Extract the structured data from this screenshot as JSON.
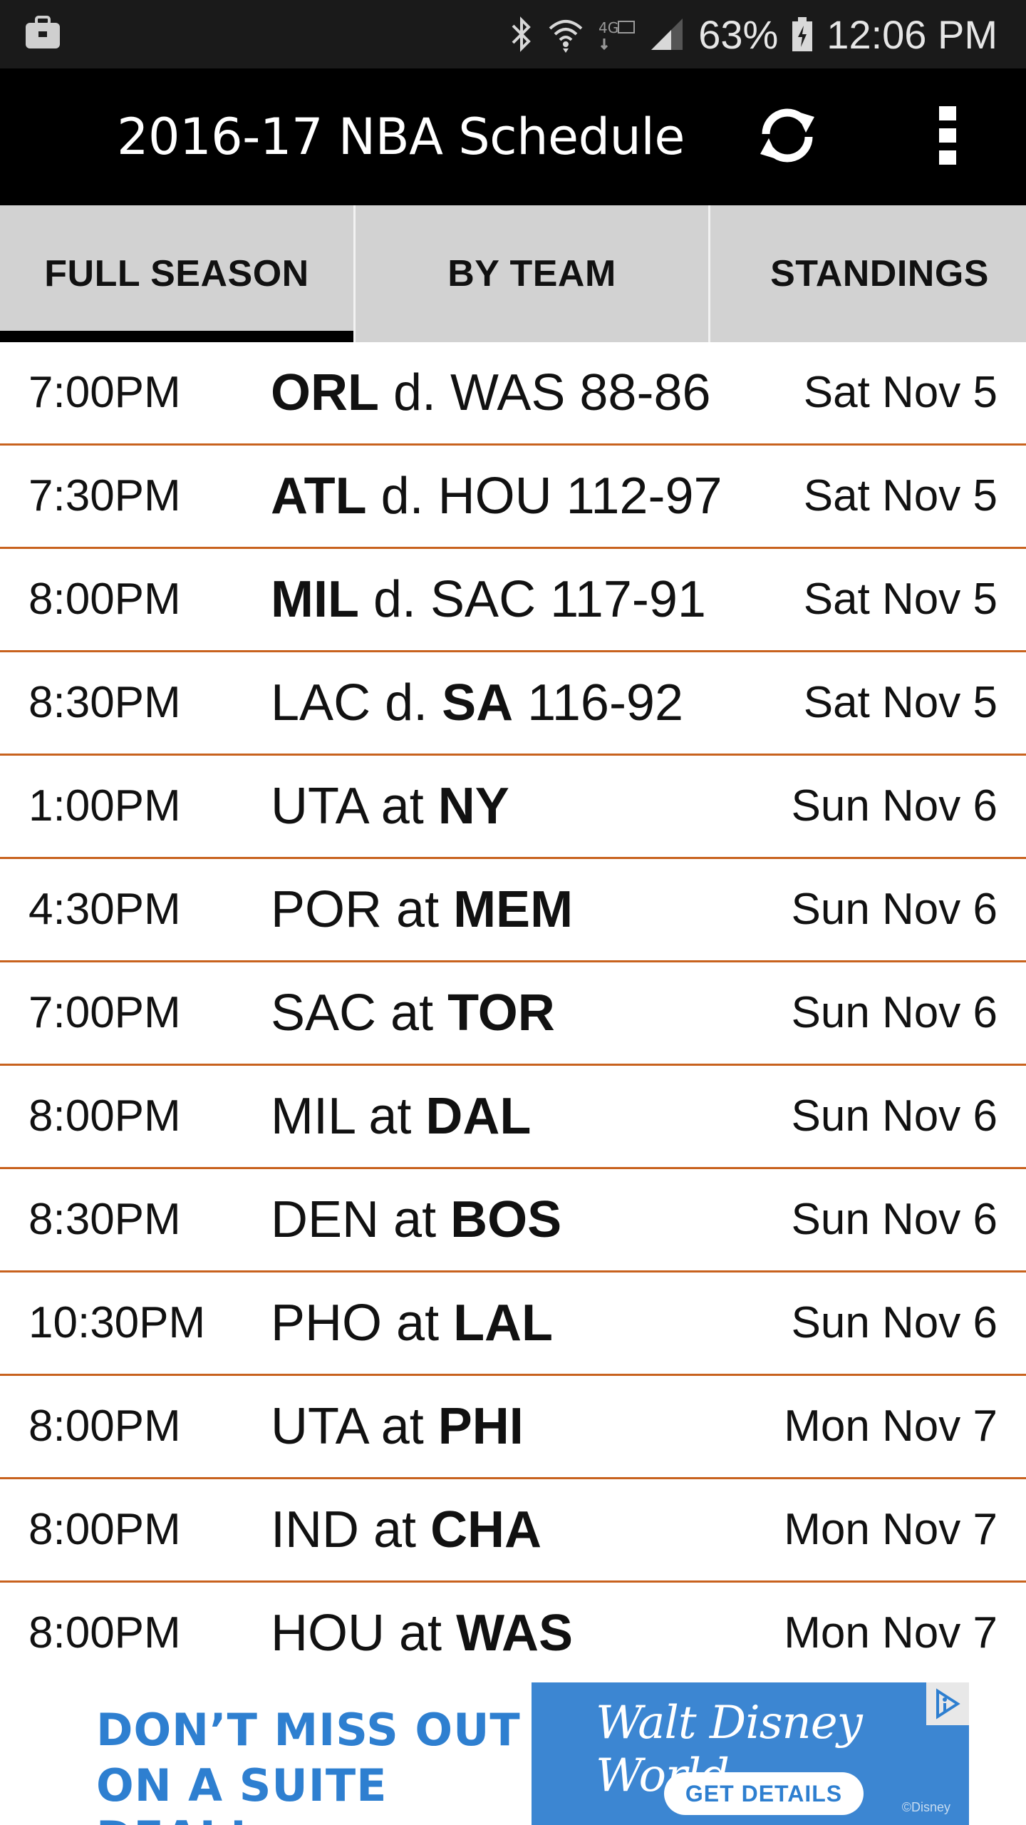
{
  "status_bar": {
    "left_icon": "briefcase-icon",
    "battery": "63%",
    "time": "12:06 PM",
    "icons": [
      "bluetooth-icon",
      "wifi-icon",
      "lte-icon",
      "signal-icon",
      "battery-charging-icon"
    ]
  },
  "app_bar": {
    "title": "2016-17 NBA Schedule",
    "refresh_icon": "refresh-icon",
    "menu_icon": "overflow-menu-icon"
  },
  "tabs": [
    {
      "label": "FULL SEASON",
      "active": true
    },
    {
      "label": "BY TEAM",
      "active": false
    },
    {
      "label": "STANDINGS",
      "active": false
    }
  ],
  "games": [
    {
      "time": "7:00PM",
      "pre": "",
      "b1": "ORL",
      "mid": " d. WAS 88-86",
      "b2": "",
      "post": "",
      "date": "Sat Nov 5"
    },
    {
      "time": "7:30PM",
      "pre": "",
      "b1": "ATL",
      "mid": " d. HOU 112-97",
      "b2": "",
      "post": "",
      "date": "Sat Nov 5"
    },
    {
      "time": "8:00PM",
      "pre": "",
      "b1": "MIL",
      "mid": " d. SAC 117-91",
      "b2": "",
      "post": "",
      "date": "Sat Nov 5"
    },
    {
      "time": "8:30PM",
      "pre": "LAC d. ",
      "b1": "SA",
      "mid": " 116-92",
      "b2": "",
      "post": "",
      "date": "Sat Nov 5"
    },
    {
      "time": "1:00PM",
      "pre": "UTA at ",
      "b1": "NY",
      "mid": "",
      "b2": "",
      "post": "",
      "date": "Sun Nov 6"
    },
    {
      "time": "4:30PM",
      "pre": "POR at ",
      "b1": "MEM",
      "mid": "",
      "b2": "",
      "post": "",
      "date": "Sun Nov 6"
    },
    {
      "time": "7:00PM",
      "pre": "SAC at ",
      "b1": "TOR",
      "mid": "",
      "b2": "",
      "post": "",
      "date": "Sun Nov 6"
    },
    {
      "time": "8:00PM",
      "pre": "MIL at ",
      "b1": "DAL",
      "mid": "",
      "b2": "",
      "post": "",
      "date": "Sun Nov 6"
    },
    {
      "time": "8:30PM",
      "pre": "DEN at ",
      "b1": "BOS",
      "mid": "",
      "b2": "",
      "post": "",
      "date": "Sun Nov 6"
    },
    {
      "time": "10:30PM",
      "pre": "PHO at ",
      "b1": "LAL",
      "mid": "",
      "b2": "",
      "post": "",
      "date": "Sun Nov 6"
    },
    {
      "time": "8:00PM",
      "pre": "UTA at ",
      "b1": "PHI",
      "mid": "",
      "b2": "",
      "post": "",
      "date": "Mon Nov 7"
    },
    {
      "time": "8:00PM",
      "pre": "IND at ",
      "b1": "CHA",
      "mid": "",
      "b2": "",
      "post": "",
      "date": "Mon Nov 7"
    },
    {
      "time": "8:00PM",
      "pre": "HOU at ",
      "b1": "WAS",
      "mid": "",
      "b2": "",
      "post": "",
      "date": "Mon Nov 7"
    }
  ],
  "ad": {
    "headline_1": "DON’T MISS OUT",
    "headline_2": "ON A SUITE DEAL!",
    "brand": "Walt Disney World.",
    "cta": "GET DETAILS",
    "copyright": "©Disney",
    "adchoices_icon": "adchoices-icon"
  },
  "colors": {
    "app_bar": "#000000",
    "status_bar": "#1a1a1a",
    "tab_bg": "#d2d2d2",
    "row_divider": "#c8621e",
    "ad_blue": "#3c86d2",
    "ad_text_blue": "#2e7fd0"
  }
}
